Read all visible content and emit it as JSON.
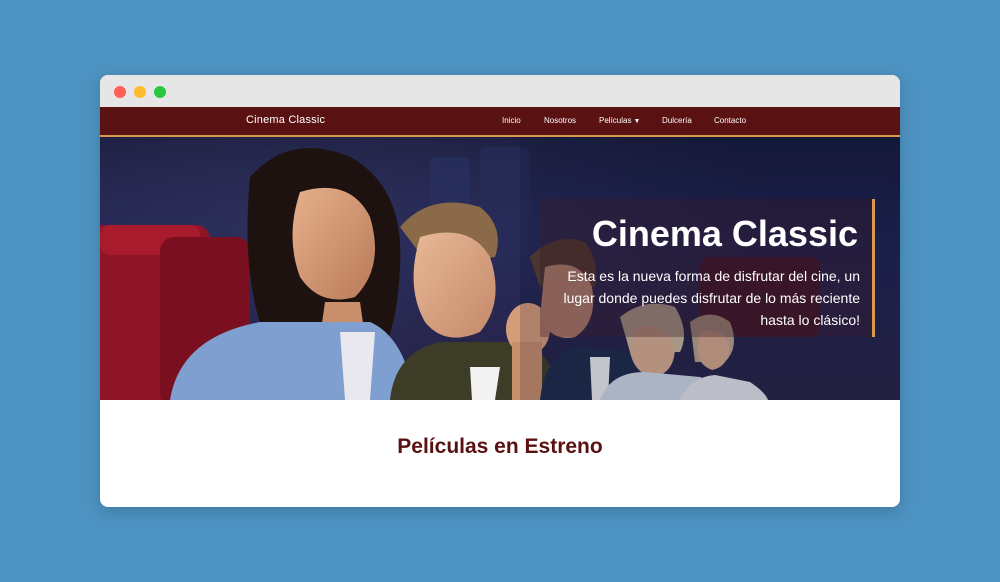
{
  "window": {
    "controls": [
      "close",
      "minimize",
      "maximize"
    ]
  },
  "navbar": {
    "brand": "Cinema Classic",
    "items": [
      {
        "label": "Inicio"
      },
      {
        "label": "Nosotros"
      },
      {
        "label": "Películas",
        "caret": "▼"
      },
      {
        "label": "Dulcería"
      },
      {
        "label": "Contacto"
      }
    ]
  },
  "hero": {
    "title": "Cinema Classic",
    "text": "Esta es la nueva forma de disfrutar del cine, un lugar donde puedes disfrutar de lo más reciente hasta lo clásico!",
    "image_alt": "audience-in-cinema-photo"
  },
  "section": {
    "title": "Películas en Estreno"
  },
  "colors": {
    "page_bg": "#4d93c2",
    "nav_bg": "#5a1111",
    "accent": "#d89a4a",
    "section_title": "#5a1111"
  }
}
